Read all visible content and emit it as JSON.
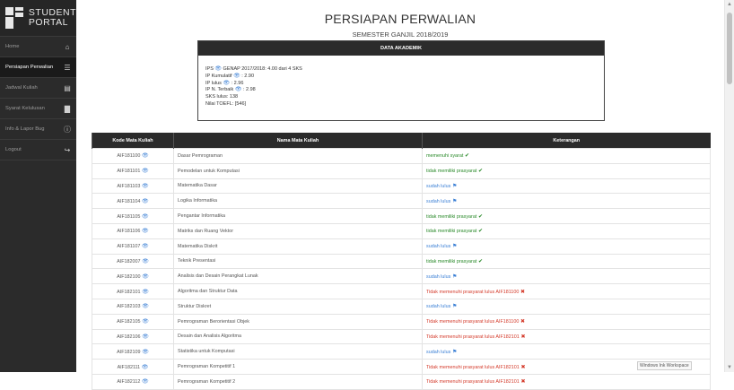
{
  "brand": {
    "line1": "STUDENT",
    "line2": "PORTAL"
  },
  "sidebar": {
    "items": [
      {
        "label": "Home",
        "icon": "home-icon",
        "glyph": "⌂"
      },
      {
        "label": "Persiapan Perwalian",
        "icon": "list-icon",
        "glyph": "☰"
      },
      {
        "label": "Jadwal Kuliah",
        "icon": "grid-icon",
        "glyph": "▤"
      },
      {
        "label": "Syarat Kelulusan",
        "icon": "book-icon",
        "glyph": "▇"
      },
      {
        "label": "Info & Lapor Bug",
        "icon": "info-icon",
        "glyph": "ⓘ"
      },
      {
        "label": "Logout",
        "icon": "logout-icon",
        "glyph": "↪"
      }
    ]
  },
  "header": {
    "title": "PERSIAPAN PERWALIAN",
    "subtitle": "SEMESTER GANJIL 2018/2019"
  },
  "akademik": {
    "heading": "DATA AKADEMIK",
    "ips_label": "IPS",
    "ips_value": " GENAP 2017/2018: 4.00 dari 4 SKS",
    "ipk_label": "IP Kumulatif",
    "ipk_value": ": 2.90",
    "ipl_label": "IP lulus",
    "ipl_value": ": 2.96",
    "ipn_label": "IP N. Terbaik",
    "ipn_value": ": 2.98",
    "sks": "SKS lulus: 138",
    "toefl": "Nilai TOEFL: [546]"
  },
  "table": {
    "headers": [
      "Kode Mata Kuliah",
      "Nama Mata Kuliah",
      "Keterangan"
    ],
    "rows": [
      {
        "kode": "AIF181100",
        "nama": "Dasar Pemrograman",
        "ket": "memenuhi syarat",
        "status": "ok"
      },
      {
        "kode": "AIF181101",
        "nama": "Pemodelan untuk Komputasi",
        "ket": "tidak memiliki prasyarat",
        "status": "ok"
      },
      {
        "kode": "AIF181103",
        "nama": "Matematika Dasar",
        "ket": "sudah lulus",
        "status": "done"
      },
      {
        "kode": "AIF181104",
        "nama": "Logika Informatika",
        "ket": "sudah lulus",
        "status": "done"
      },
      {
        "kode": "AIF181105",
        "nama": "Pengantar Informatika",
        "ket": "tidak memiliki prasyarat",
        "status": "ok"
      },
      {
        "kode": "AIF181106",
        "nama": "Matriks dan Ruang Vektor",
        "ket": "tidak memiliki prasyarat",
        "status": "ok"
      },
      {
        "kode": "AIF181107",
        "nama": "Matematika Diskrit",
        "ket": "sudah lulus",
        "status": "done"
      },
      {
        "kode": "AIF182007",
        "nama": "Teknik Presentasi",
        "ket": "tidak memiliki prasyarat",
        "status": "ok"
      },
      {
        "kode": "AIF182100",
        "nama": "Analisis dan Desain Perangkat Lunak",
        "ket": "sudah lulus",
        "status": "done"
      },
      {
        "kode": "AIF182101",
        "nama": "Algoritma dan Struktur Data",
        "ket": "Tidak memenuhi prasyarat lulus AIF181100",
        "status": "bad"
      },
      {
        "kode": "AIF182103",
        "nama": "Struktur Diskret",
        "ket": "sudah lulus",
        "status": "done"
      },
      {
        "kode": "AIF182105",
        "nama": "Pemrograman Berorientasi Objek",
        "ket": "Tidak memenuhi prasyarat lulus AIF181100",
        "status": "bad"
      },
      {
        "kode": "AIF182106",
        "nama": "Desain dan Analisis Algoritma",
        "ket": "Tidak memenuhi prasyarat lulus AIF182101",
        "status": "bad"
      },
      {
        "kode": "AIF182109",
        "nama": "Statistika untuk Komputasi",
        "ket": "sudah lulus",
        "status": "done"
      },
      {
        "kode": "AIF182111",
        "nama": "Pemrograman Kompetitif 1",
        "ket": "Tidak memenuhi prasyarat lulus AIF182101",
        "status": "bad"
      },
      {
        "kode": "AIF182112",
        "nama": "Pemrograman Kompetitif 2",
        "ket": "Tidak memenuhi prasyarat lulus AIF182101",
        "status": "bad"
      }
    ]
  },
  "tooltip": "Windows Ink Workspace",
  "colors": {
    "sidebar": "#2b2b2b",
    "ok": "#2a8a2a",
    "bad": "#d43a2a",
    "info": "#3a7fd5"
  }
}
